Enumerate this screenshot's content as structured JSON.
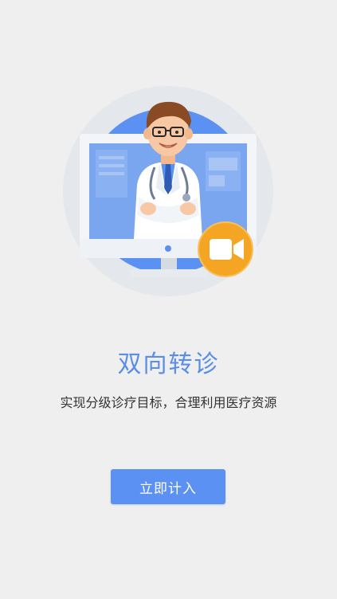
{
  "onboarding": {
    "title": "双向转诊",
    "subtitle": "实现分级诊疗目标，合理利用医疗资源",
    "cta_label": "立即计入"
  },
  "colors": {
    "background": "#efefef",
    "accent": "#5b91f2",
    "title": "#5a8de8",
    "camera_badge": "#f5a524"
  },
  "illustration": {
    "icons": [
      "doctor-illustration",
      "computer-monitor-icon",
      "video-camera-icon"
    ]
  }
}
